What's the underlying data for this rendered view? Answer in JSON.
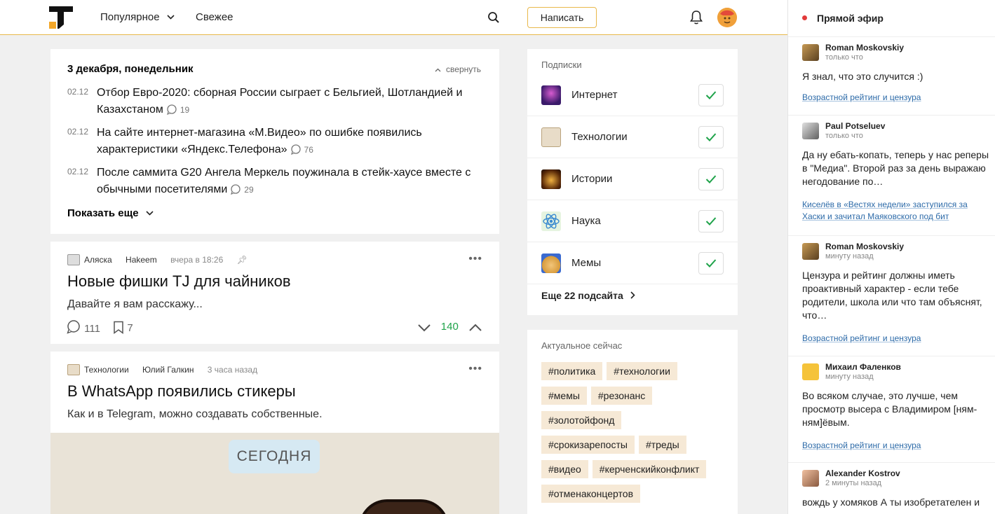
{
  "header": {
    "nav_popular": "Популярное",
    "nav_fresh": "Свежее",
    "write_button": "Написать"
  },
  "news": {
    "date_heading": "3 декабря, понедельник",
    "collapse_label": "свернуть",
    "items": [
      {
        "date": "02.12",
        "title": "Отбор Евро-2020: сборная России сыграет с Бельгией, Шотландией и Казахстаном",
        "comments": "19"
      },
      {
        "date": "02.12",
        "title": "На сайте интернет-магазина «М.Видео» по ошибке появились характеристики «Яндекс.Телефона»",
        "comments": "76"
      },
      {
        "date": "02.12",
        "title": "После саммита G20 Ангела Меркель поужинала в стейк-хаусе вместе с обычными посетителями",
        "comments": "29"
      }
    ],
    "show_more": "Показать еще"
  },
  "posts": [
    {
      "subsite": "Аляска",
      "author": "Hakeem",
      "time": "вчера в 18:26",
      "title": "Новые фишки TJ для чайников",
      "subtitle": "Давайте я вам расскажу...",
      "comments": "111",
      "bookmarks": "7",
      "rating": "140"
    },
    {
      "subsite": "Технологии",
      "author": "Юлий Галкин",
      "time": "3 часа назад",
      "title": "В WhatsApp появились стикеры",
      "subtitle": "Как и в Telegram, можно создавать собственные.",
      "image_label": "СЕГОДНЯ"
    }
  ],
  "subscriptions": {
    "title": "Подписки",
    "items": [
      {
        "name": "Интернет"
      },
      {
        "name": "Технологии"
      },
      {
        "name": "Истории"
      },
      {
        "name": "Наука"
      },
      {
        "name": "Мемы"
      }
    ],
    "more": "Еще 22 подсайта"
  },
  "trending": {
    "title": "Актуальное сейчас",
    "tags": [
      "#политика",
      "#технологии",
      "#мемы",
      "#резонанс",
      "#золотойфонд",
      "#срокизарепосты",
      "#треды",
      "#видео",
      "#керченскийконфликт",
      "#отменаконцертов"
    ]
  },
  "live": {
    "title": "Прямой эфир",
    "comments": [
      {
        "author": "Roman Moskovskiy",
        "time": "только что",
        "text": "Я знал, что это случится :)",
        "link": "Возрастной рейтинг и цензура"
      },
      {
        "author": "Paul Potseluev",
        "time": "только что",
        "text": "Да ну ебать-копать, теперь у нас реперы в \"Медиа\". Второй раз за день выражаю негодование по…",
        "link": "Киселёв в «Вестях недели» заступился за Хаски и зачитал Маяковского под бит"
      },
      {
        "author": "Roman Moskovskiy",
        "time": "минуту назад",
        "text": "Цензура и рейтинг должны иметь проактивный характер - если тебе родители, школа или что там объяснят, что…",
        "link": "Возрастной рейтинг и цензура"
      },
      {
        "author": "Михаил Фаленков",
        "time": "минуту назад",
        "text": "Во всяком случае, это лучше, чем просмотр высера с Владимиром [ням-ням]ёвым.",
        "link": "Возрастной рейтинг и цензура"
      },
      {
        "author": "Alexander Kostrov",
        "time": "2 минуты назад",
        "text": "вождь у хомяков А ты изобретателен и",
        "link": ""
      }
    ]
  },
  "colors": {
    "accent": "#e8b84a",
    "upvote_green": "#1fa34a",
    "tag_bg": "#f6e9d6",
    "link_blue": "#2c6aa8",
    "live_dot": "#e23a3a"
  }
}
